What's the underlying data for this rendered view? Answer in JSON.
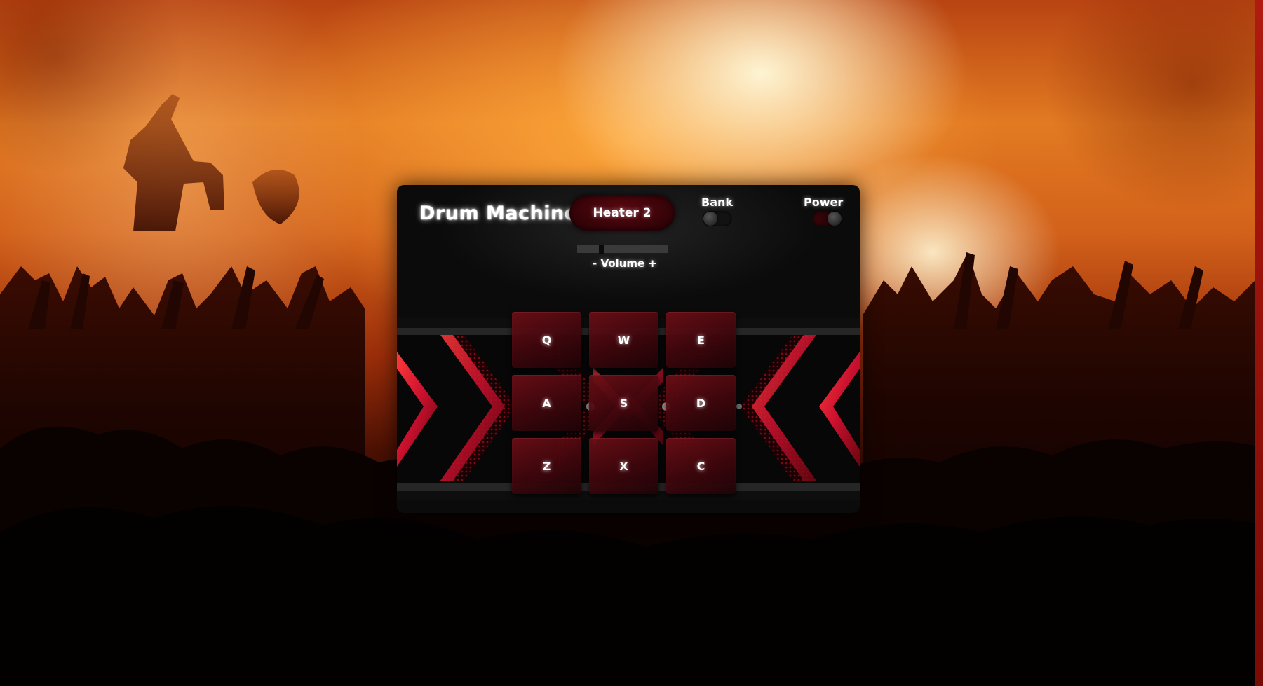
{
  "app": {
    "title": "Drum Machine",
    "display_text": "Heater 2"
  },
  "controls": {
    "bank_label": "Bank",
    "power_label": "Power",
    "volume_label": "- Volume +",
    "volume_level": 0.25
  },
  "pads": [
    {
      "key": "Q"
    },
    {
      "key": "W"
    },
    {
      "key": "E"
    },
    {
      "key": "A"
    },
    {
      "key": "S"
    },
    {
      "key": "D"
    },
    {
      "key": "Z"
    },
    {
      "key": "X"
    },
    {
      "key": "C"
    }
  ],
  "colors": {
    "accent": "#c8102e",
    "panel": "#0b0b0b",
    "pad": "#4a0810"
  }
}
